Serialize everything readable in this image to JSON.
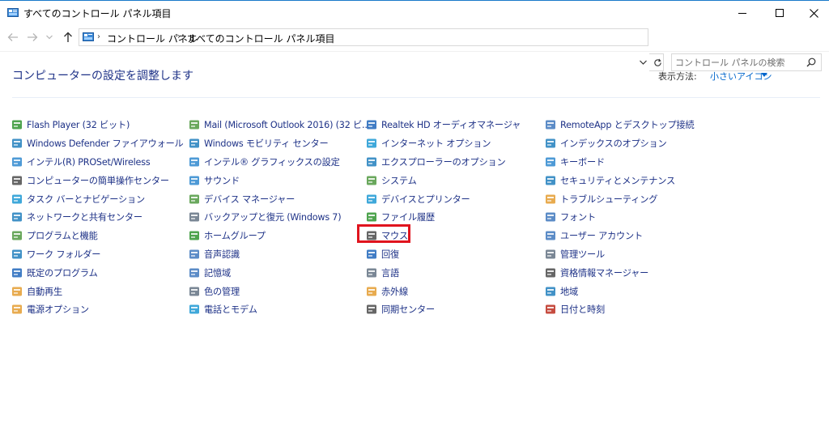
{
  "window": {
    "title": "すべてのコントロール パネル項目"
  },
  "address": {
    "crumbs": [
      "コントロール パネル",
      "すべてのコントロール パネル項目"
    ]
  },
  "search": {
    "placeholder": "コントロール パネルの検索"
  },
  "header": {
    "title": "コンピューターの設定を調整します",
    "view_label": "表示方法:",
    "view_value": "小さいアイコン"
  },
  "columns": [
    [
      {
        "label": "Flash Player (32 ビット)",
        "icon": "flash-icon"
      },
      {
        "label": "Windows Defender ファイアウォール",
        "icon": "firewall-icon"
      },
      {
        "label": "インテル(R) PROSet/Wireless",
        "icon": "wireless-icon"
      },
      {
        "label": "コンピューターの簡単操作センター",
        "icon": "ease-of-access-icon"
      },
      {
        "label": "タスク バーとナビゲーション",
        "icon": "taskbar-icon"
      },
      {
        "label": "ネットワークと共有センター",
        "icon": "network-icon"
      },
      {
        "label": "プログラムと機能",
        "icon": "programs-icon"
      },
      {
        "label": "ワーク フォルダー",
        "icon": "work-folders-icon"
      },
      {
        "label": "既定のプログラム",
        "icon": "default-programs-icon"
      },
      {
        "label": "自動再生",
        "icon": "autoplay-icon"
      },
      {
        "label": "電源オプション",
        "icon": "power-icon"
      }
    ],
    [
      {
        "label": "Mail (Microsoft Outlook 2016) (32 ビ...",
        "icon": "mail-icon"
      },
      {
        "label": "Windows モビリティ センター",
        "icon": "mobility-icon"
      },
      {
        "label": "インテル® グラフィックスの設定",
        "icon": "graphics-icon"
      },
      {
        "label": "サウンド",
        "icon": "sound-icon"
      },
      {
        "label": "デバイス マネージャー",
        "icon": "device-manager-icon"
      },
      {
        "label": "バックアップと復元 (Windows 7)",
        "icon": "backup-icon"
      },
      {
        "label": "ホームグループ",
        "icon": "homegroup-icon"
      },
      {
        "label": "音声認識",
        "icon": "microphone-icon"
      },
      {
        "label": "記憶域",
        "icon": "storage-icon"
      },
      {
        "label": "色の管理",
        "icon": "color-management-icon"
      },
      {
        "label": "電話とモデム",
        "icon": "phone-modem-icon"
      }
    ],
    [
      {
        "label": "Realtek HD オーディオマネージャ",
        "icon": "realtek-icon"
      },
      {
        "label": "インターネット オプション",
        "icon": "internet-options-icon"
      },
      {
        "label": "エクスプローラーのオプション",
        "icon": "explorer-options-icon"
      },
      {
        "label": "システム",
        "icon": "system-icon"
      },
      {
        "label": "デバイスとプリンター",
        "icon": "printer-icon"
      },
      {
        "label": "ファイル履歴",
        "icon": "file-history-icon"
      },
      {
        "label": "マウス",
        "icon": "mouse-icon"
      },
      {
        "label": "回復",
        "icon": "recovery-icon"
      },
      {
        "label": "言語",
        "icon": "language-icon"
      },
      {
        "label": "赤外線",
        "icon": "infrared-icon"
      },
      {
        "label": "同期センター",
        "icon": "sync-icon"
      }
    ],
    [
      {
        "label": "RemoteApp とデスクトップ接続",
        "icon": "remoteapp-icon"
      },
      {
        "label": "インデックスのオプション",
        "icon": "indexing-icon"
      },
      {
        "label": "キーボード",
        "icon": "keyboard-icon"
      },
      {
        "label": "セキュリティとメンテナンス",
        "icon": "security-flag-icon"
      },
      {
        "label": "トラブルシューティング",
        "icon": "troubleshoot-icon"
      },
      {
        "label": "フォント",
        "icon": "fonts-icon"
      },
      {
        "label": "ユーザー アカウント",
        "icon": "user-accounts-icon"
      },
      {
        "label": "管理ツール",
        "icon": "admin-tools-icon"
      },
      {
        "label": "資格情報マネージャー",
        "icon": "credential-icon"
      },
      {
        "label": "地域",
        "icon": "region-icon"
      },
      {
        "label": "日付と時刻",
        "icon": "date-time-icon"
      }
    ]
  ],
  "colors": {
    "link": "#1e3287",
    "accent": "#0066cc",
    "highlight": "#e0141e"
  }
}
